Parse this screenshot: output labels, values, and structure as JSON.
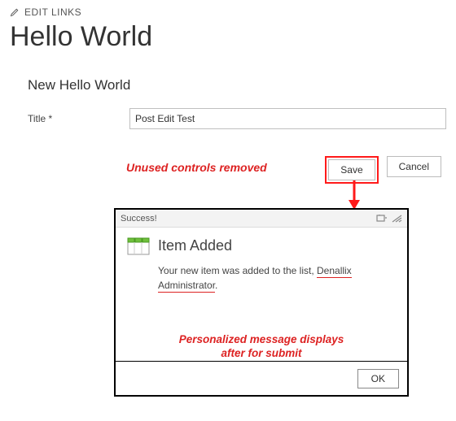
{
  "header": {
    "edit_links": "EDIT LINKS",
    "page_title": "Hello World"
  },
  "form": {
    "subheader": "New Hello World",
    "title_label": "Title *",
    "title_value": "Post Edit Test",
    "save_label": "Save",
    "cancel_label": "Cancel"
  },
  "annotations": {
    "removed": "Unused controls removed",
    "personalized_line1": "Personalized message displays",
    "personalized_line2": "after for submit"
  },
  "dialog": {
    "caption": "Success!",
    "heading": "Item Added",
    "message_prefix": "Your new item was added to the list, ",
    "user_name": "Denallix Administrator",
    "message_suffix": ".",
    "ok_label": "OK"
  }
}
